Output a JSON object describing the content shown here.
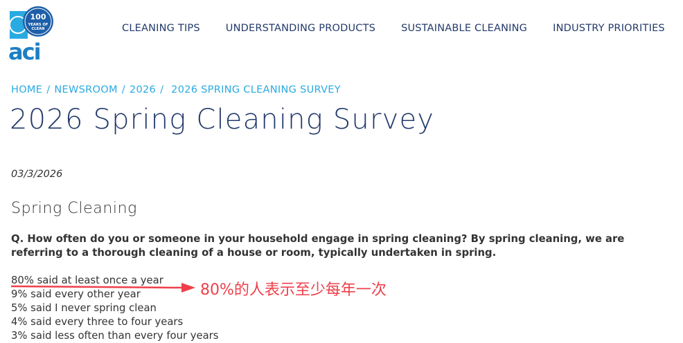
{
  "logo": {
    "badge_number": "100",
    "badge_text_1": "YEARS OF",
    "badge_text_2": "CLEAN",
    "wordmark": "aci"
  },
  "nav": {
    "items": [
      {
        "label": "CLEANING TIPS"
      },
      {
        "label": "UNDERSTANDING PRODUCTS"
      },
      {
        "label": "SUSTAINABLE CLEANING"
      },
      {
        "label": "INDUSTRY PRIORITIES"
      }
    ]
  },
  "breadcrumb": {
    "home": "HOME",
    "newsroom": "NEWSROOM",
    "year": "2026",
    "current": "2026 SPRING CLEANING SURVEY",
    "separator": "/"
  },
  "article": {
    "title": "2026 Spring Cleaning Survey",
    "date": "03/3/2026",
    "section_heading": "Spring Cleaning",
    "question": "Q. How often do you or someone in your household engage in spring cleaning? By spring cleaning, we are referring to a thorough cleaning of a house or room, typically undertaken in spring.",
    "answers": [
      "80% said at least once a year",
      "9% said every other year",
      "5% said I never spring clean",
      "4% said every three to four years",
      "3% said less often than every four years"
    ]
  },
  "annotation": {
    "text": "80%的人表示至少每年一次",
    "color": "#ee3f4a"
  },
  "colors": {
    "brand_navy": "#233a6b",
    "brand_blue": "#29aae1",
    "logo_blue": "#1d7fc4"
  }
}
